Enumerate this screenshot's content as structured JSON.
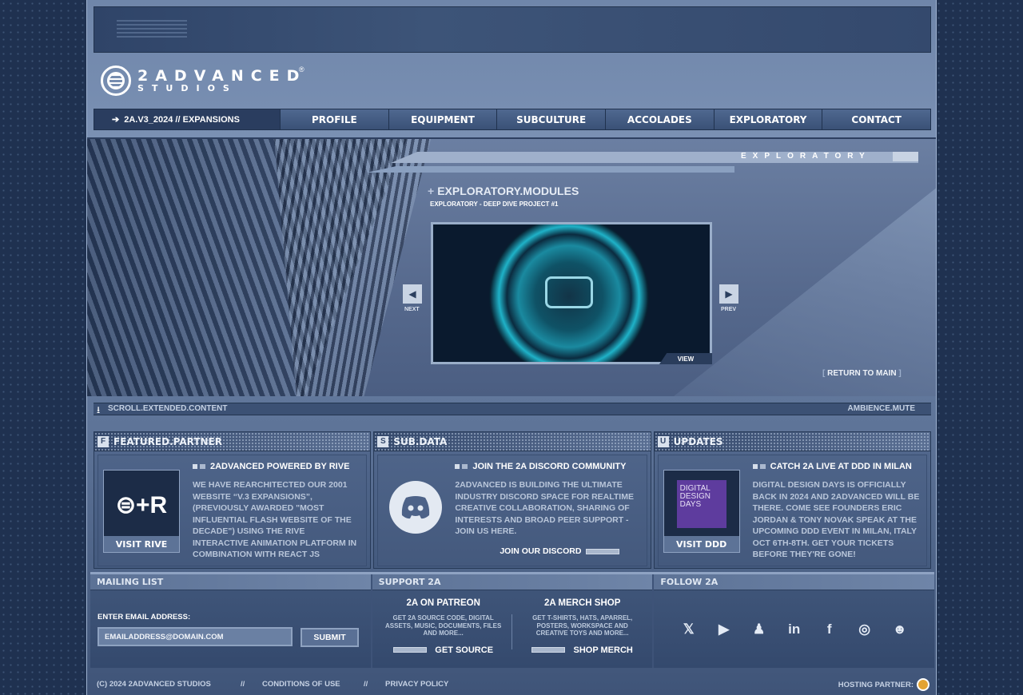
{
  "nav": {
    "home": "2A.V3_2024 // EXPANSIONS",
    "items": [
      "PROFILE",
      "EQUIPMENT",
      "SUBCULTURE",
      "ACCOLADES",
      "EXPLORATORY",
      "CONTACT"
    ]
  },
  "logo": {
    "line1": "2ADVANCED",
    "line2": "STUDIOS",
    "reg": "®"
  },
  "hero": {
    "section": "EXPLORATORY",
    "title": "EXPLORATORY.MODULES",
    "subtitle": "EXPLORATORY - DEEP DIVE PROJECT #1",
    "view": "VIEW",
    "next": "NEXT",
    "prev": "PREV",
    "return_label": "RETURN TO MAIN"
  },
  "scroll": {
    "left": "SCROLL.EXTENDED.CONTENT",
    "right": "AMBIENCE.MUTE"
  },
  "cards": [
    {
      "letter": "F",
      "header": "FEATURED.PARTNER",
      "title": "2ADVANCED POWERED BY RIVE",
      "text": "WE HAVE REARCHITECTED OUR 2001 WEBSITE “V.3 EXPANSIONS”, (PREVIOUSLY AWARDED \"MOST INFLUENTIAL FLASH WEBSITE OF THE DECADE\") USING THE RIVE INTERACTIVE ANIMATION PLATFORM IN COMBINATION WITH REACT JS",
      "thumb_caption": "VISIT RIVE"
    },
    {
      "letter": "S",
      "header": "SUB.DATA",
      "title": "JOIN THE 2A DISCORD COMMUNITY",
      "text": "2ADVANCED IS BUILDING THE ULTIMATE INDUSTRY DISCORD SPACE FOR REALTIME CREATIVE COLLABORATION, SHARING OF INTERESTS AND BROAD PEER SUPPORT - JOIN US HERE.",
      "link": "JOIN OUR DISCORD"
    },
    {
      "letter": "U",
      "header": "UPDATES",
      "title": "CATCH 2A LIVE AT DDD IN MILAN",
      "text": "DIGITAL DESIGN DAYS IS OFFICIALLY BACK IN 2024 AND 2ADVANCED WILL BE THERE. COME SEE FOUNDERS ERIC JORDAN & TONY NOVAK SPEAK AT THE UPCOMING DDD EVENT IN MILAN, ITALY OCT 6TH-8TH. GET YOUR TICKETS BEFORE THEY'RE GONE!",
      "thumb_caption": "VISIT DDD",
      "thumb_text": "DIGITAL DESIGN DAYS"
    }
  ],
  "mailing": {
    "header": "MAILING LIST",
    "label": "ENTER EMAIL ADDRESS:",
    "placeholder": "EMAILADDRESS@DOMAIN.COM",
    "submit": "SUBMIT"
  },
  "support": {
    "header": "SUPPORT 2A",
    "patreon": {
      "title": "2A ON PATREON",
      "desc": "GET 2A SOURCE CODE, DIGITAL ASSETS, MUSIC, DOCUMENTS, FILES AND MORE...",
      "link": "GET SOURCE"
    },
    "merch": {
      "title": "2A MERCH SHOP",
      "desc": "GET T-SHIRTS, HATS, APARREL, POSTERS, WORKSPACE AND CREATIVE TOYS AND MORE...",
      "link": "SHOP MERCH"
    }
  },
  "follow": {
    "header": "FOLLOW 2A",
    "icons": [
      "x-icon",
      "youtube-icon",
      "github-icon",
      "linkedin-icon",
      "facebook-icon",
      "instagram-icon",
      "discord-icon"
    ]
  },
  "footer": {
    "copyright": "(C) 2024 2ADVANCED STUDIOS",
    "sep": "//",
    "conditions": "CONDITIONS OF USE",
    "privacy": "PRIVACY POLICY",
    "hosting": "HOSTING PARTNER:"
  }
}
